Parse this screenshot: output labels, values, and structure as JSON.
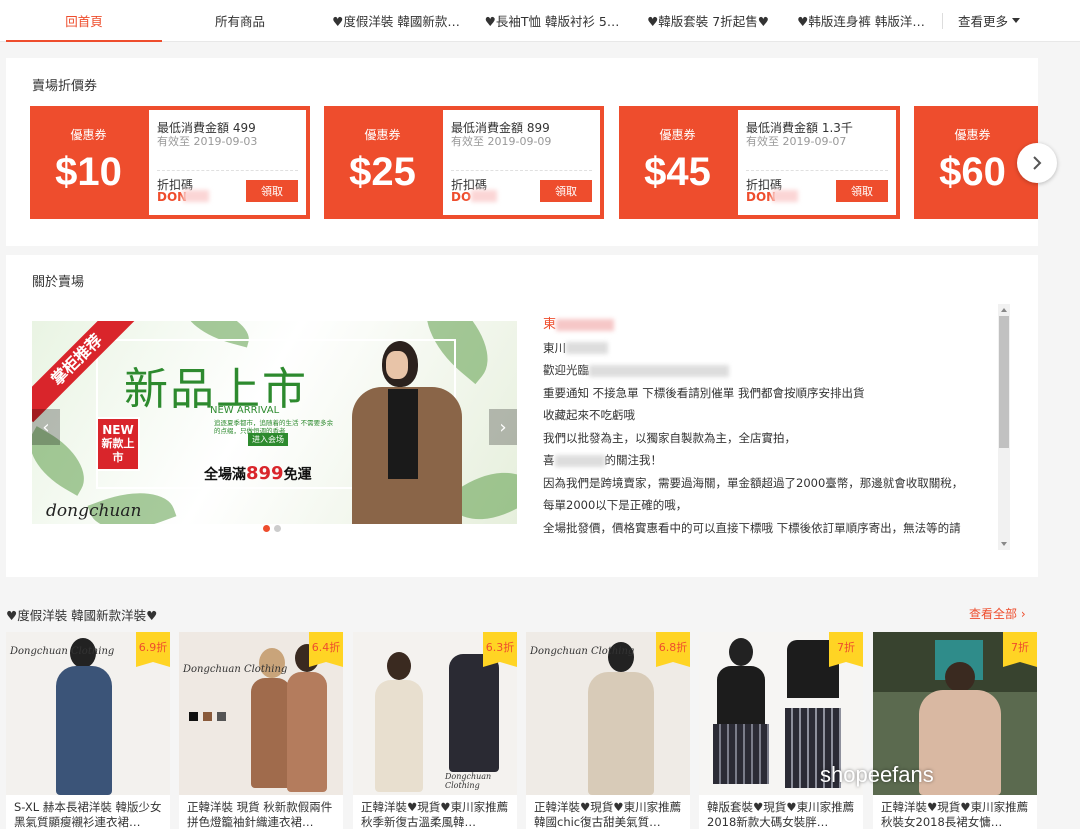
{
  "nav": {
    "items": [
      "回首頁",
      "所有商品",
      "♥度假洋裝 韓國新款…",
      "♥長袖T恤 韓版衬衫 5…",
      "♥韓版套裝 7折起售♥",
      "♥韩版连身裤 韩版洋…"
    ],
    "more": "查看更多"
  },
  "coupons": {
    "title": "賣場折價券",
    "items": [
      {
        "label": "優惠券",
        "amount": "$10",
        "min": "最低消費金額 499",
        "valid": "有效至 2019-09-03",
        "code_label": "折扣碼",
        "code": "DON",
        "button": "領取"
      },
      {
        "label": "優惠券",
        "amount": "$25",
        "min": "最低消費金額 899",
        "valid": "有效至 2019-09-09",
        "code_label": "折扣碼",
        "code": "DO",
        "button": "領取"
      },
      {
        "label": "優惠券",
        "amount": "$45",
        "min": "最低消費金額 1.3千",
        "valid": "有效至 2019-09-07",
        "code_label": "折扣碼",
        "code": "DON",
        "button": "領取"
      },
      {
        "label": "優惠券",
        "amount": "$60"
      }
    ]
  },
  "about": {
    "title": "關於賣場",
    "banner": {
      "ribbon": "掌柜推荐",
      "title": "新品上市",
      "subtitle": "NEW ARRIVAL",
      "small": "追逐夏季都市，追随着的生活 不需要多余的点缀，只做恒调的香者",
      "enter": "进入会场",
      "badge_new": "NEW",
      "badge_text": "新款上市",
      "free_ship_prefix": "全場滿",
      "free_ship_amount": "899",
      "free_ship_suffix": "免運",
      "brand": "dongchuan"
    },
    "lines": [
      "東",
      "東川",
      "歡迎光臨",
      "重要通知 不接急單 下標後看請別催單 我們都會按順序安排出貨",
      "收藏起來不吃虧哦",
      "我們以批發為主，以獨家自製款為主，全店實拍，",
      "喜",
      "的關注我！",
      "因為我們是跨境賣家，需要過海關，單金額超過了2000臺幣，那邊就會收取關稅，",
      "每單2000以下是正確的哦，",
      "全場批發價，價格實惠看中的可以直接下標哦 下標後依訂單順序寄出，無法等的請"
    ]
  },
  "products": {
    "section_title": "♥度假洋裝 韓國新款洋裝♥",
    "see_all": "查看全部",
    "items": [
      {
        "discount": "6.9折",
        "name": "S-XL 赫本長裙洋裝 韓版少女黑氣質顯瘦襯衫連衣裙…",
        "brand": "Dongchuan Clothing"
      },
      {
        "discount": "6.4折",
        "name": "正韓洋裝 現貨 秋新款假兩件拼色燈籠袖針織連衣裙…",
        "brand": "Dongchuan Clothing"
      },
      {
        "discount": "6.3折",
        "name": "正韓洋裝♥現貨♥東川家推薦 秋季新復古溫柔風韓…",
        "brand": "Dongchuan Clothing"
      },
      {
        "discount": "6.8折",
        "name": "正韓洋裝♥現貨♥東川家推薦 韓國chic復古甜美氣質…",
        "brand": "Dongchuan Clothing"
      },
      {
        "discount": "7折",
        "name": "韓版套裝♥現貨♥東川家推薦 2018新款大碼女裝胖…"
      },
      {
        "discount": "7折",
        "name": "正韓洋裝♥現貨♥東川家推薦 秋裝女2018長裙女慵…"
      }
    ]
  },
  "watermark": "shopeefans"
}
